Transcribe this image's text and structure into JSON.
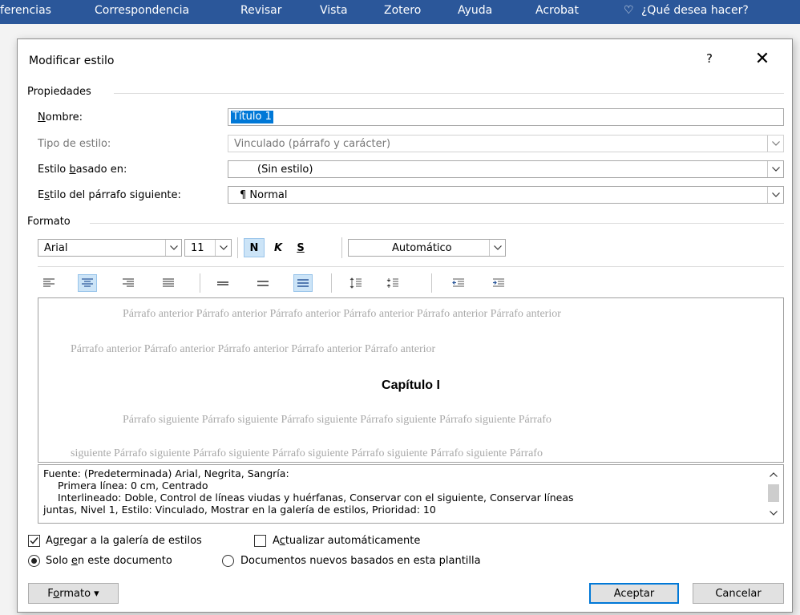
{
  "ribbon": {
    "tabs": [
      "ferencias",
      "Correspondencia",
      "Revisar",
      "Vista",
      "Zotero",
      "Ayuda",
      "Acrobat"
    ],
    "tell_me": "¿Qué desea hacer?"
  },
  "dialog": {
    "title": "Modificar estilo",
    "help": "?",
    "close": "✕"
  },
  "properties": {
    "section": "Propiedades",
    "name_label": "Nombre:",
    "name_value": "Título 1",
    "type_label": "Tipo de estilo:",
    "type_value": "Vinculado (párrafo y carácter)",
    "based_label": "Estilo basado en:",
    "based_value": "(Sin estilo)",
    "next_label": "Estilo del párrafo siguiente:",
    "next_value": "¶ Normal"
  },
  "format": {
    "section": "Formato",
    "font": "Arial",
    "size": "11",
    "bold": "N",
    "italic": "K",
    "underline": "S",
    "color": "Automático"
  },
  "preview": {
    "prev_line1": "Párrafo anterior Párrafo anterior Párrafo anterior Párrafo anterior Párrafo anterior Párrafo anterior",
    "prev_line2": "Párrafo anterior Párrafo anterior Párrafo anterior Párrafo anterior Párrafo anterior",
    "heading": "Capítulo I",
    "next_line1": "Párrafo siguiente Párrafo siguiente Párrafo siguiente Párrafo siguiente Párrafo siguiente Párrafo",
    "next_line2": "siguiente Párrafo siguiente Párrafo siguiente Párrafo siguiente Párrafo siguiente Párrafo siguiente Párrafo"
  },
  "description": {
    "line1": "Fuente: (Predeterminada) Arial, Negrita, Sangría:",
    "line2": "Primera línea:  0 cm, Centrado",
    "line3": "Interlineado:  Doble, Control de líneas viudas y huérfanas, Conservar con el siguiente, Conservar líneas",
    "line4": "juntas, Nivel 1, Estilo: Vinculado, Mostrar en la galería de estilos, Prioridad: 10"
  },
  "options": {
    "add_gallery": "Agregar a la galería de estilos",
    "auto_update": "Actualizar automáticamente",
    "only_doc": "Solo en este documento",
    "new_docs": "Documentos nuevos basados en esta plantilla"
  },
  "buttons": {
    "format": "Formato",
    "ok": "Aceptar",
    "cancel": "Cancelar"
  }
}
